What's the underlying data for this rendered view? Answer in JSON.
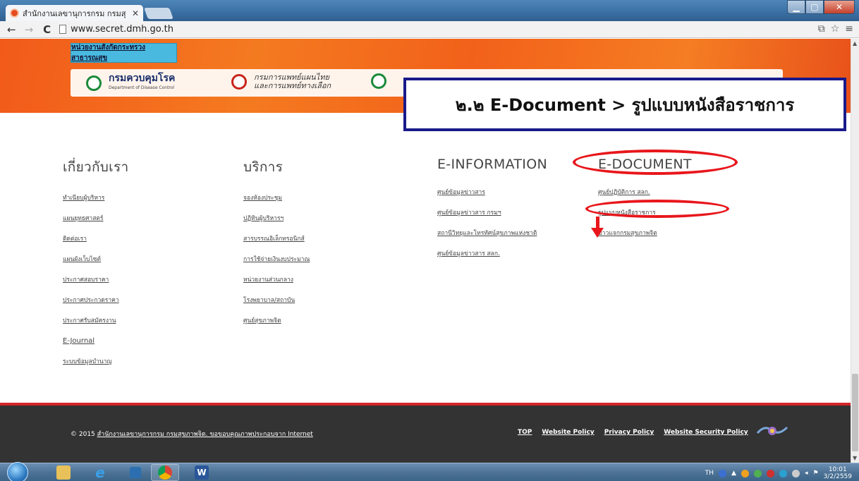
{
  "browser": {
    "tab_title": "สำนักงานเลขานุการกรม กรมสุ",
    "tab_close": "✕",
    "url": "www.secret.dmh.go.th"
  },
  "banner": {
    "agency_tab": "หน่วยงานสังกัดกระทรวงสาธารณสุข",
    "orgs": [
      {
        "name": "กรมควบคุมโรค",
        "sub": "Department of Disease Control"
      },
      {
        "name": "กรมการแพทย์แผนไทย และการแพทย์ทางเลือก"
      }
    ]
  },
  "callout": {
    "text": "๒.๒ E-Document > รูปแบบหนังสือราชการ"
  },
  "columns": [
    {
      "heading": "เกี่ยวกับเรา",
      "links": [
        "ทำเนียบผู้บริหาร",
        "แผนยุทธศาสตร์",
        "ติดต่อเรา",
        "แผนผังเว็บไซต์",
        "ประกาศสอบราคา",
        "ประกาศประกวดราคา",
        "ประกาศรับสมัครงาน",
        "E-Journal",
        "ระบบข้อมูลบำนาญ"
      ]
    },
    {
      "heading": "บริการ",
      "links": [
        "จองห้องประชุม",
        "ปฏิทินผู้บริหารฯ",
        "สารบรรณอิเล็กทรอนิกส์",
        "การใช้จ่ายเงินงบประมาณ",
        "หน่วยงานส่วนกลาง",
        "โรงพยาบาล/สถาบัน",
        "ศูนย์สุขภาพจิต"
      ]
    },
    {
      "heading": "E-INFORMATION",
      "links": [
        "ศูนย์ข้อมูลข่าวสาร",
        "ศูนย์ข้อมูลข่าวสาร กรมฯ",
        "สถานีวิทยุและโทรทัศน์สุขภาพแห่งชาติ",
        "ศูนย์ข้อมูลข่าวสาร สลก."
      ]
    },
    {
      "heading": "E-DOCUMENT",
      "links": [
        "ศูนย์ปฏิบัติการ สลก.",
        "รูปแบบหนังสือราชการ",
        "ข่าวแจกกรมสุขภาพจิต"
      ]
    }
  ],
  "footer": {
    "year": "© 2015",
    "copy_link": "สำนักงานเลขานุการกรม กรมสุขภาพจิต. ขอขอบคุณภาพประกอบจาก Internet",
    "links": [
      "TOP",
      "Website Policy",
      "Privacy Policy",
      "Website Security Policy"
    ]
  },
  "taskbar": {
    "lang": "TH",
    "time": "10:01",
    "date": "3/2/2559"
  },
  "colors": {
    "banner_orange": "#f47a20",
    "highlight_red": "#e8161b",
    "callout_border": "#1a1a8a",
    "footer_bg": "#333333",
    "footer_accent": "#d3262a"
  }
}
